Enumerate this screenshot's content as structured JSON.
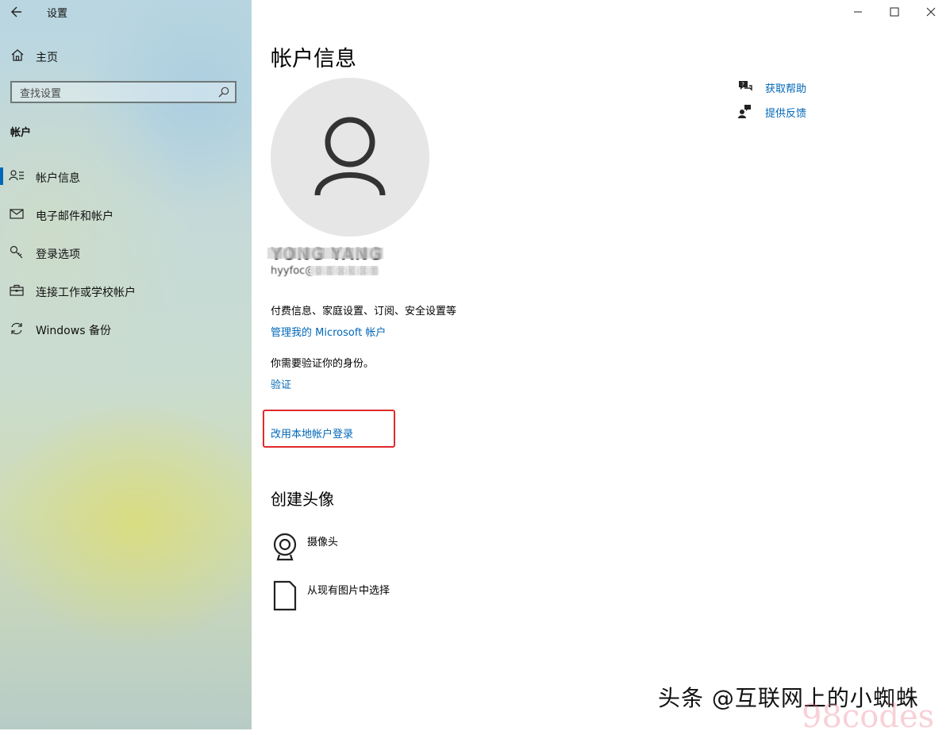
{
  "window": {
    "title": "设置",
    "controls": [
      "minimize",
      "maximize",
      "close"
    ]
  },
  "sidebar": {
    "home_label": "主页",
    "search_placeholder": "查找设置",
    "section_label": "帐户",
    "items": [
      {
        "label": "帐户信息",
        "icon": "person-lines-icon",
        "active": true
      },
      {
        "label": "电子邮件和帐户",
        "icon": "mail-icon",
        "active": false
      },
      {
        "label": "登录选项",
        "icon": "key-icon",
        "active": false
      },
      {
        "label": "连接工作或学校帐户",
        "icon": "briefcase-icon",
        "active": false
      },
      {
        "label": "Windows 备份",
        "icon": "sync-icon",
        "active": false
      }
    ]
  },
  "main": {
    "title": "帐户信息",
    "user_name": "YONG YANG",
    "user_email": "hyyfoc@outlook.com",
    "billing_text": "付费信息、家庭设置、订阅、安全设置等",
    "manage_link": "管理我的 Microsoft 帐户",
    "verify_text": "你需要验证你的身份。",
    "verify_link": "验证",
    "local_account_link": "改用本地帐户登录",
    "avatar_section_title": "创建头像",
    "avatar_options": [
      {
        "label": "摄像头",
        "icon": "webcam-icon"
      },
      {
        "label": "从现有图片中选择",
        "icon": "picture-file-icon"
      }
    ],
    "help_links": [
      {
        "label": "获取帮助",
        "icon": "help-chat-icon"
      },
      {
        "label": "提供反馈",
        "icon": "feedback-icon"
      }
    ]
  },
  "watermark": {
    "text": "头条 @互联网上的小蜘蛛",
    "text2": "98codes"
  },
  "colors": {
    "accent": "#0067b8",
    "highlight": "#e02a2a"
  }
}
